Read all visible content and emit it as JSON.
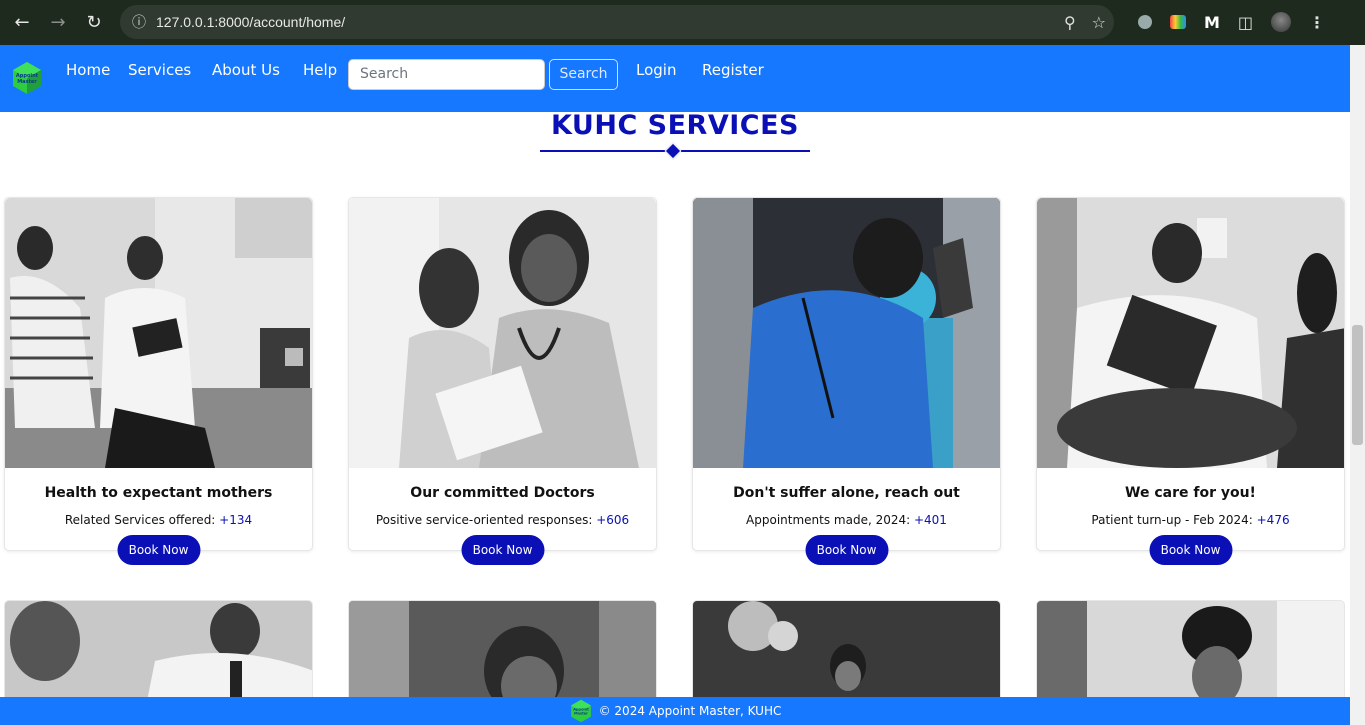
{
  "browser": {
    "url_host": "127.0.0.1",
    "url_port_path": ":8000/account/home/"
  },
  "navbar": {
    "logo_text": "Appoint Master",
    "links": [
      "Home",
      "Services",
      "About Us",
      "Help"
    ],
    "search_placeholder": "Search",
    "search_button": "Search",
    "auth_links": [
      "Login",
      "Register"
    ]
  },
  "section": {
    "heading": "KUHC SERVICES"
  },
  "cards": [
    {
      "title": "Health to expectant mothers",
      "stat_label": "Related Services offered: ",
      "stat_value": "+134",
      "button": "Book Now"
    },
    {
      "title": "Our committed Doctors",
      "stat_label": "Positive service-oriented responses: ",
      "stat_value": "+606",
      "button": "Book Now"
    },
    {
      "title": "Don't suffer alone, reach out",
      "stat_label": "Appointments made, 2024: ",
      "stat_value": "+401",
      "button": "Book Now"
    },
    {
      "title": "We care for you!",
      "stat_label": "Patient turn-up - Feb 2024: ",
      "stat_value": "+476",
      "button": "Book Now"
    }
  ],
  "footer": {
    "text": "© 2024 Appoint Master, KUHC"
  },
  "colors": {
    "brand_blue": "#1677ff",
    "accent_navy": "#0a10b5"
  }
}
